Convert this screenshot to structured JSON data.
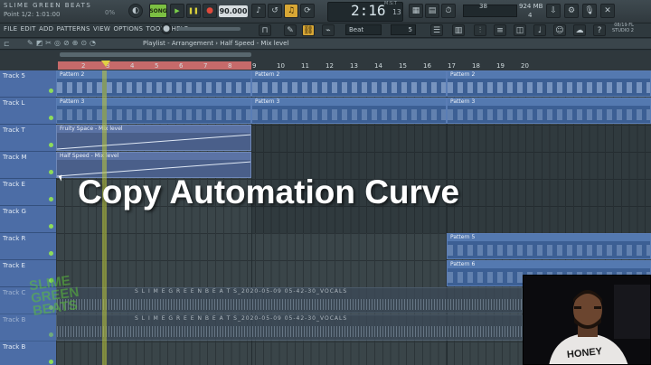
{
  "app": {
    "title": "SLIME GREEN BEATS",
    "position_hint": "Point 1/2: 1:01:00",
    "cpu_pct": "0%"
  },
  "transport": {
    "mode_label": "SONG",
    "play_icon": "play-icon",
    "pause_icon": "pause-icon",
    "stop_icon": "stop-icon",
    "record_icon": "record-icon",
    "tempo": "90.000",
    "time_main": "2:16",
    "time_sub": "13",
    "time_label": "M:S:T",
    "cpu_value": "38",
    "memory": "924 MB",
    "polyphony": "4"
  },
  "menu": {
    "items_text": "FILE  EDIT  ADD  PATTERNS  VIEW  OPTIONS  TOOLS  HELP",
    "snap_mode": "Beat",
    "snap_value": "5",
    "hint_top": "08/19  FL",
    "hint_bottom": "STUDIO 2"
  },
  "playlist": {
    "title": "Playlist - Arrangement  ›  Half Speed - Mix level",
    "ruler": [
      "2",
      "3",
      "4",
      "5",
      "6",
      "7",
      "8",
      "9",
      "10",
      "11",
      "12",
      "13",
      "14",
      "15",
      "16",
      "17",
      "18",
      "19",
      "20"
    ],
    "tracks": [
      {
        "name": "Track 5"
      },
      {
        "name": "Track L"
      },
      {
        "name": "Track T"
      },
      {
        "name": "Track M"
      },
      {
        "name": "Track E"
      },
      {
        "name": "Track G"
      },
      {
        "name": "Track R"
      },
      {
        "name": "Track E"
      },
      {
        "name": "Track C"
      },
      {
        "name": "Track B"
      },
      {
        "name": "Track B"
      }
    ],
    "clips": {
      "p2": "Pattern 2",
      "p3": "Pattern 3",
      "p5": "Pattern 5",
      "p6": "Pattern 6",
      "auto1": "Fruity Space - Mix level",
      "auto2": "Half Speed - Mix level",
      "audio1": "S L I M E  G R E E N  B E A T S_2020-05-09 05-42-30_VOCALS",
      "audio2": "S L I M E  G R E E N  B E A T S_2020-05-09 05-42-30_VOCALS"
    }
  },
  "overlay": {
    "caption": "Copy Automation Curve",
    "watermark_line1": "SLIME",
    "watermark_line2": "GREEN",
    "watermark_line3": "BEATS",
    "webcam_shirt": "HONEY"
  },
  "colors": {
    "accent_green": "#7cc043",
    "track_header": "#4c6da6",
    "pattern_clip": "#3c5f94",
    "loop_range": "#c66a6a"
  }
}
